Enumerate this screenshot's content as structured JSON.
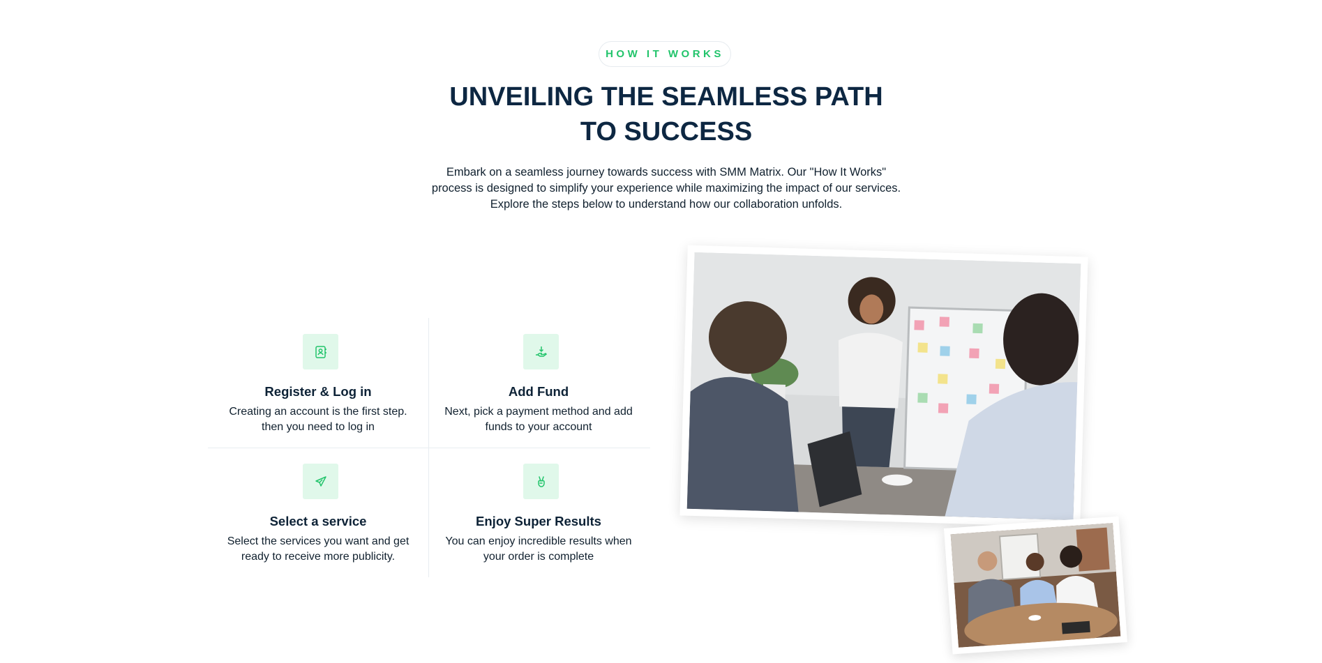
{
  "section": {
    "badge": "HOW IT WORKS",
    "title_line1": "UNVEILING THE SEAMLESS PATH",
    "title_line2": "TO SUCCESS",
    "intro": "Embark on a seamless journey towards success with SMM Matrix. Our \"How It Works\" process is designed to simplify your experience while maximizing the impact of our services. Explore the steps below to understand how our collaboration unfolds."
  },
  "steps": [
    {
      "icon": "contact-book-icon",
      "title": "Register & Log in",
      "description": "Creating an account is the first step. then you need to log in"
    },
    {
      "icon": "hand-money-icon",
      "title": "Add Fund",
      "description": "Next, pick a payment method and add funds to your account"
    },
    {
      "icon": "paper-plane-icon",
      "title": "Select a service",
      "description": "Select the services you want and get ready to receive more publicity."
    },
    {
      "icon": "peace-hand-icon",
      "title": "Enjoy Super Results",
      "description": "You can enjoy incredible results when your order is complete"
    }
  ],
  "colors": {
    "accent": "#22c46b",
    "heading": "#0d2742",
    "icon_bg": "#e0f8ea"
  }
}
